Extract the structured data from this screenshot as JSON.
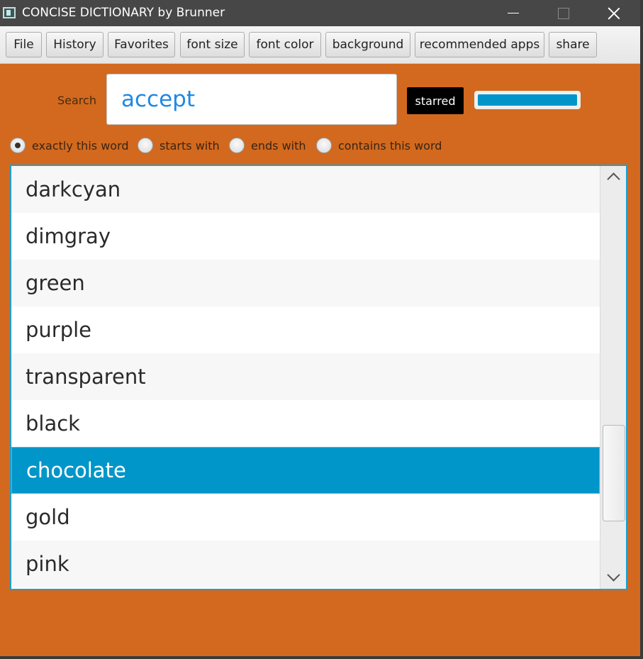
{
  "window": {
    "title": "CONCISE DICTIONARY by Brunner",
    "background_color": "#d2691e"
  },
  "menu": {
    "items": [
      "File",
      "History",
      "Favorites",
      "font size",
      "font color",
      "background",
      "recommended apps",
      "share"
    ]
  },
  "search": {
    "label": "Search",
    "value": "accept",
    "starred_label": "starred",
    "progress_fraction": 1.0
  },
  "match_modes": {
    "options": [
      "exactly this word",
      "starts with",
      "ends with",
      "contains this word"
    ],
    "selected": "exactly this word"
  },
  "word_list": {
    "items": [
      "darkcyan",
      "dimgray",
      "green",
      "purple",
      "transparent",
      "black",
      "chocolate",
      "gold",
      "pink"
    ],
    "selected": "chocolate",
    "selection_color": "#0096c9"
  },
  "icons": {
    "app": "dictionary-app-icon",
    "minimize": "minimize-icon",
    "maximize": "maximize-icon",
    "close": "close-icon",
    "scroll_up": "chevron-up-icon",
    "scroll_down": "chevron-down-icon"
  }
}
